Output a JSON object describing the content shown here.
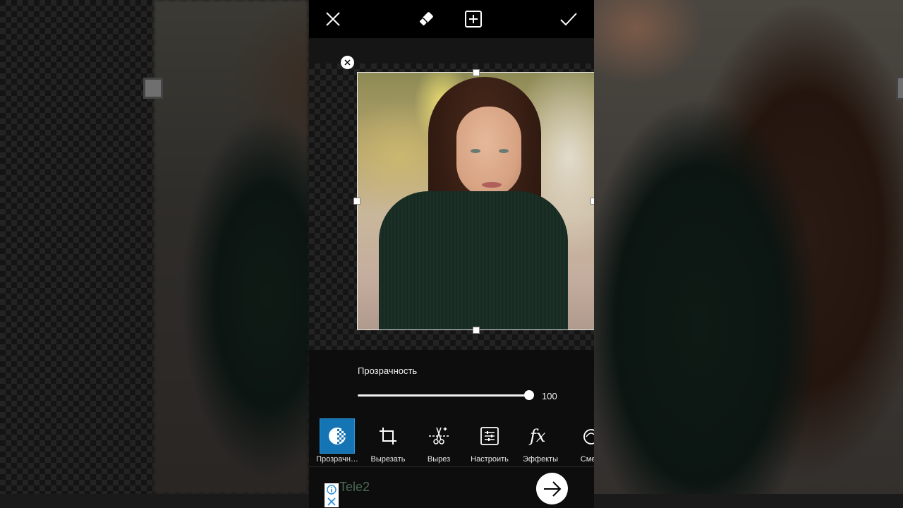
{
  "topbar": {
    "close_icon": "close-icon",
    "eraser_icon": "eraser-icon",
    "add_icon": "add-layer-icon",
    "apply_icon": "checkmark-icon"
  },
  "opacity": {
    "label": "Прозрачность",
    "value": "100",
    "level": 1.0
  },
  "tools": [
    {
      "label": "Прозрачн…",
      "icon": "transparency-icon",
      "active": true
    },
    {
      "label": "Вырезать",
      "icon": "crop-icon",
      "active": false
    },
    {
      "label": "Вырез",
      "icon": "cutout-icon",
      "active": false
    },
    {
      "label": "Настроить",
      "icon": "adjust-icon",
      "active": false
    },
    {
      "label": "Эффекты",
      "icon": "fx-icon",
      "active": false
    },
    {
      "label": "Смеш",
      "icon": "blend-icon",
      "active": false
    }
  ],
  "ad": {
    "title": "Tele2"
  },
  "colors": {
    "accent": "#1474b4",
    "background": "#0d0d0d"
  }
}
